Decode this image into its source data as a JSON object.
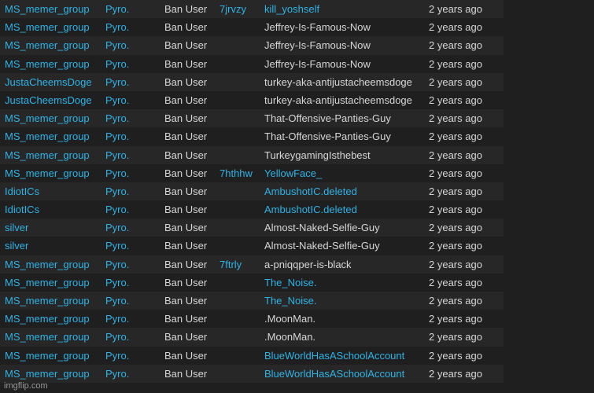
{
  "rows": [
    {
      "user": "MS_memer_group",
      "mod": "Pyro.",
      "action": "Ban User",
      "id": "7jrvzy",
      "target": "kill_yoshself",
      "target_link": true,
      "time": "2 years ago"
    },
    {
      "user": "MS_memer_group",
      "mod": "Pyro.",
      "action": "Ban User",
      "id": "",
      "target": "Jeffrey-Is-Famous-Now",
      "target_link": false,
      "time": "2 years ago"
    },
    {
      "user": "MS_memer_group",
      "mod": "Pyro.",
      "action": "Ban User",
      "id": "",
      "target": "Jeffrey-Is-Famous-Now",
      "target_link": false,
      "time": "2 years ago"
    },
    {
      "user": "MS_memer_group",
      "mod": "Pyro.",
      "action": "Ban User",
      "id": "",
      "target": "Jeffrey-Is-Famous-Now",
      "target_link": false,
      "time": "2 years ago"
    },
    {
      "user": "JustaCheemsDoge",
      "mod": "Pyro.",
      "action": "Ban User",
      "id": "",
      "target": "turkey-aka-antijustacheemsdoge",
      "target_link": false,
      "time": "2 years ago"
    },
    {
      "user": "JustaCheemsDoge",
      "mod": "Pyro.",
      "action": "Ban User",
      "id": "",
      "target": "turkey-aka-antijustacheemsdoge",
      "target_link": false,
      "time": "2 years ago"
    },
    {
      "user": "MS_memer_group",
      "mod": "Pyro.",
      "action": "Ban User",
      "id": "",
      "target": "That-Offensive-Panties-Guy",
      "target_link": false,
      "time": "2 years ago"
    },
    {
      "user": "MS_memer_group",
      "mod": "Pyro.",
      "action": "Ban User",
      "id": "",
      "target": "That-Offensive-Panties-Guy",
      "target_link": false,
      "time": "2 years ago"
    },
    {
      "user": "MS_memer_group",
      "mod": "Pyro.",
      "action": "Ban User",
      "id": "",
      "target": "TurkeygamingIsthebest",
      "target_link": false,
      "time": "2 years ago"
    },
    {
      "user": "MS_memer_group",
      "mod": "Pyro.",
      "action": "Ban User",
      "id": "7hthhw",
      "target": "YellowFace_",
      "target_link": true,
      "time": "2 years ago"
    },
    {
      "user": "IdiotICs",
      "mod": "Pyro.",
      "action": "Ban User",
      "id": "",
      "target": "AmbushotIC.deleted",
      "target_link": true,
      "time": "2 years ago"
    },
    {
      "user": "IdiotICs",
      "mod": "Pyro.",
      "action": "Ban User",
      "id": "",
      "target": "AmbushotIC.deleted",
      "target_link": true,
      "time": "2 years ago"
    },
    {
      "user": "silver",
      "mod": "Pyro.",
      "action": "Ban User",
      "id": "",
      "target": "Almost-Naked-Selfie-Guy",
      "target_link": false,
      "time": "2 years ago"
    },
    {
      "user": "silver",
      "mod": "Pyro.",
      "action": "Ban User",
      "id": "",
      "target": "Almost-Naked-Selfie-Guy",
      "target_link": false,
      "time": "2 years ago"
    },
    {
      "user": "MS_memer_group",
      "mod": "Pyro.",
      "action": "Ban User",
      "id": "7ftrly",
      "target": "a-pniqqper-is-black",
      "target_link": false,
      "time": "2 years ago"
    },
    {
      "user": "MS_memer_group",
      "mod": "Pyro.",
      "action": "Ban User",
      "id": "",
      "target": "The_Noise.",
      "target_link": true,
      "time": "2 years ago"
    },
    {
      "user": "MS_memer_group",
      "mod": "Pyro.",
      "action": "Ban User",
      "id": "",
      "target": "The_Noise.",
      "target_link": true,
      "time": "2 years ago"
    },
    {
      "user": "MS_memer_group",
      "mod": "Pyro.",
      "action": "Ban User",
      "id": "",
      "target": ".MoonMan.",
      "target_link": false,
      "time": "2 years ago"
    },
    {
      "user": "MS_memer_group",
      "mod": "Pyro.",
      "action": "Ban User",
      "id": "",
      "target": ".MoonMan.",
      "target_link": false,
      "time": "2 years ago"
    },
    {
      "user": "MS_memer_group",
      "mod": "Pyro.",
      "action": "Ban User",
      "id": "",
      "target": "BlueWorldHasASchoolAccount",
      "target_link": true,
      "time": "2 years ago"
    },
    {
      "user": "MS_memer_group",
      "mod": "Pyro.",
      "action": "Ban User",
      "id": "",
      "target": "BlueWorldHasASchoolAccount",
      "target_link": true,
      "time": "2 years ago"
    }
  ],
  "watermark": "imgflip.com",
  "colors": {
    "link": "#2fb3e6",
    "text": "#d6d6d6",
    "row_odd": "#272727",
    "row_even": "#1f1f1f"
  }
}
